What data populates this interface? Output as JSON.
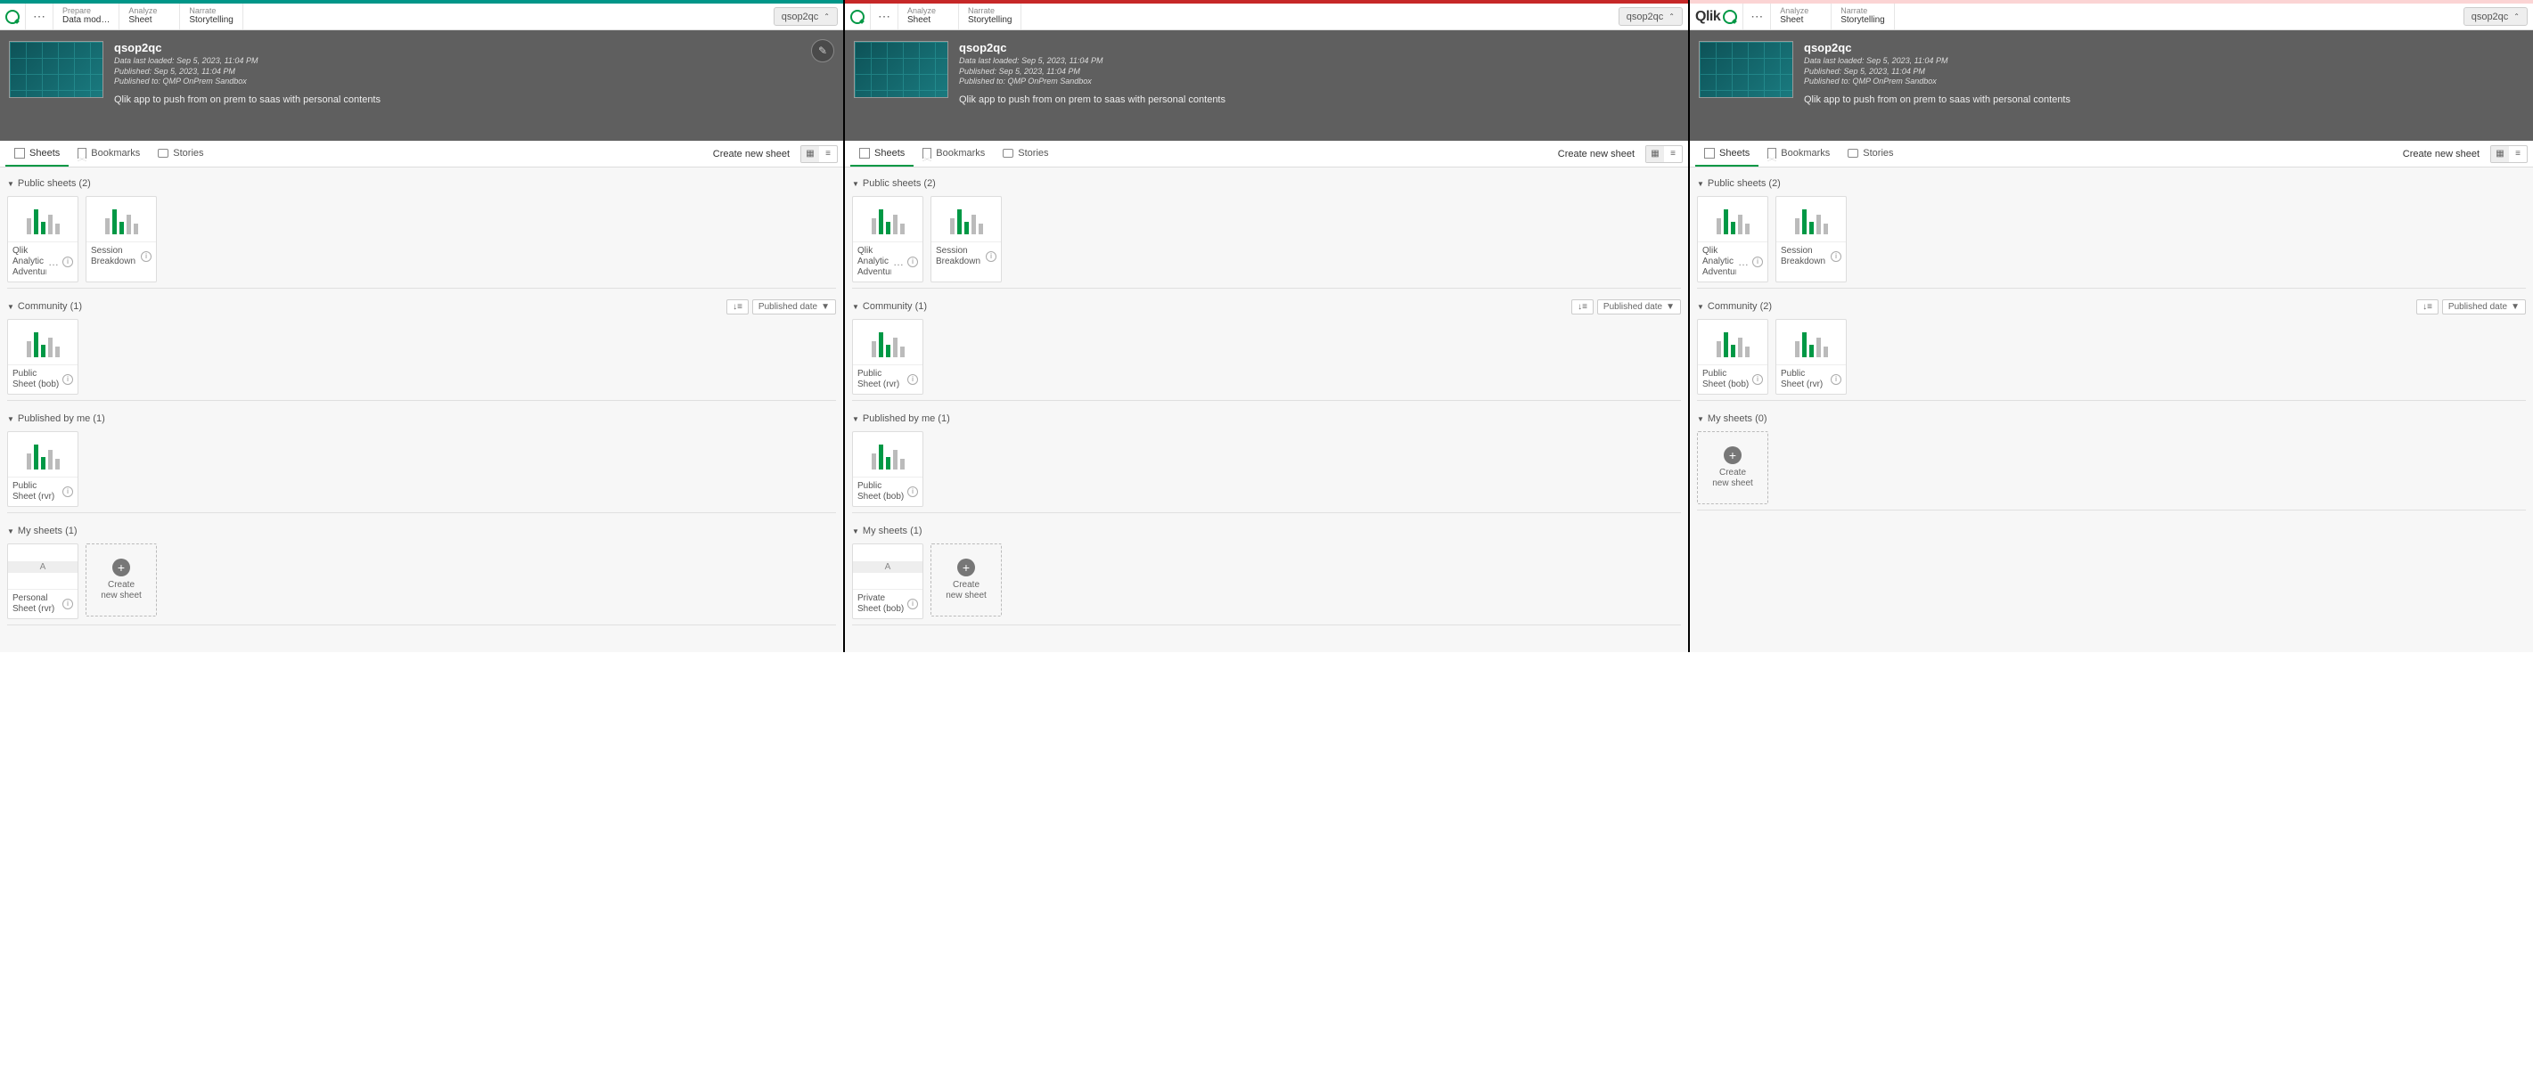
{
  "common": {
    "app_name": "qsop2qc",
    "nav": {
      "prepare_sup": "Prepare",
      "prepare_sub": "Data mod…",
      "analyze_sup": "Analyze",
      "analyze_sub": "Sheet",
      "narrate_sup": "Narrate",
      "narrate_sub": "Storytelling"
    },
    "hero": {
      "title": "qsop2qc",
      "meta1": "Data last loaded: Sep 5, 2023, 11:04 PM",
      "meta2": "Published: Sep 5, 2023, 11:04 PM",
      "meta3": "Published to: QMP OnPrem Sandbox",
      "desc": "Qlik app to push from on prem to saas with personal contents"
    },
    "tabs": {
      "sheets": "Sheets",
      "bookmarks": "Bookmarks",
      "stories": "Stories"
    },
    "create_new_sheet": "Create new sheet",
    "sort_label": "Published date",
    "create_tile": "Create new sheet",
    "personal_badge": "A",
    "qlik_brand": "Qlik"
  },
  "panes": [
    {
      "accent": "teal",
      "show_prepare": true,
      "show_edit_badge": true,
      "show_brand_text": false,
      "sections": [
        {
          "title": "Public sheets (2)",
          "tiles": [
            {
              "label": "Qlik Analytic Adventure",
              "dots": true,
              "info": true
            },
            {
              "label": "Session Breakdown",
              "info": true
            }
          ]
        },
        {
          "title": "Community (1)",
          "sortable": true,
          "tiles": [
            {
              "label": "Public Sheet (bob)",
              "info": true
            }
          ]
        },
        {
          "title": "Published by me (1)",
          "tiles": [
            {
              "label": "Public Sheet (rvr)",
              "info": true
            }
          ]
        },
        {
          "title": "My sheets (1)",
          "tiles": [
            {
              "label": "Personal Sheet (rvr)",
              "personal": true,
              "info": true
            },
            {
              "create": true
            }
          ]
        }
      ]
    },
    {
      "accent": "red",
      "show_prepare": false,
      "show_edit_badge": false,
      "show_brand_text": false,
      "sections": [
        {
          "title": "Public sheets (2)",
          "tiles": [
            {
              "label": "Qlik Analytic Adventure",
              "dots": true,
              "info": true
            },
            {
              "label": "Session Breakdown",
              "info": true
            }
          ]
        },
        {
          "title": "Community (1)",
          "sortable": true,
          "tiles": [
            {
              "label": "Public Sheet (rvr)",
              "info": true
            }
          ]
        },
        {
          "title": "Published by me (1)",
          "tiles": [
            {
              "label": "Public Sheet (bob)",
              "info": true
            }
          ]
        },
        {
          "title": "My sheets (1)",
          "tiles": [
            {
              "label": "Private Sheet (bob)",
              "personal": true,
              "info": true
            },
            {
              "create": true
            }
          ]
        }
      ]
    },
    {
      "accent": "pink",
      "show_prepare": false,
      "show_edit_badge": false,
      "show_brand_text": true,
      "sections": [
        {
          "title": "Public sheets (2)",
          "tiles": [
            {
              "label": "Qlik Analytic Adventure",
              "dots": true,
              "info": true
            },
            {
              "label": "Session Breakdown",
              "info": true
            }
          ]
        },
        {
          "title": "Community (2)",
          "sortable": true,
          "tiles": [
            {
              "label": "Public Sheet (bob)",
              "info": true
            },
            {
              "label": "Public Sheet (rvr)",
              "info": true
            }
          ]
        },
        {
          "title": "My sheets (0)",
          "tiles": [
            {
              "create": true
            }
          ]
        }
      ]
    }
  ]
}
